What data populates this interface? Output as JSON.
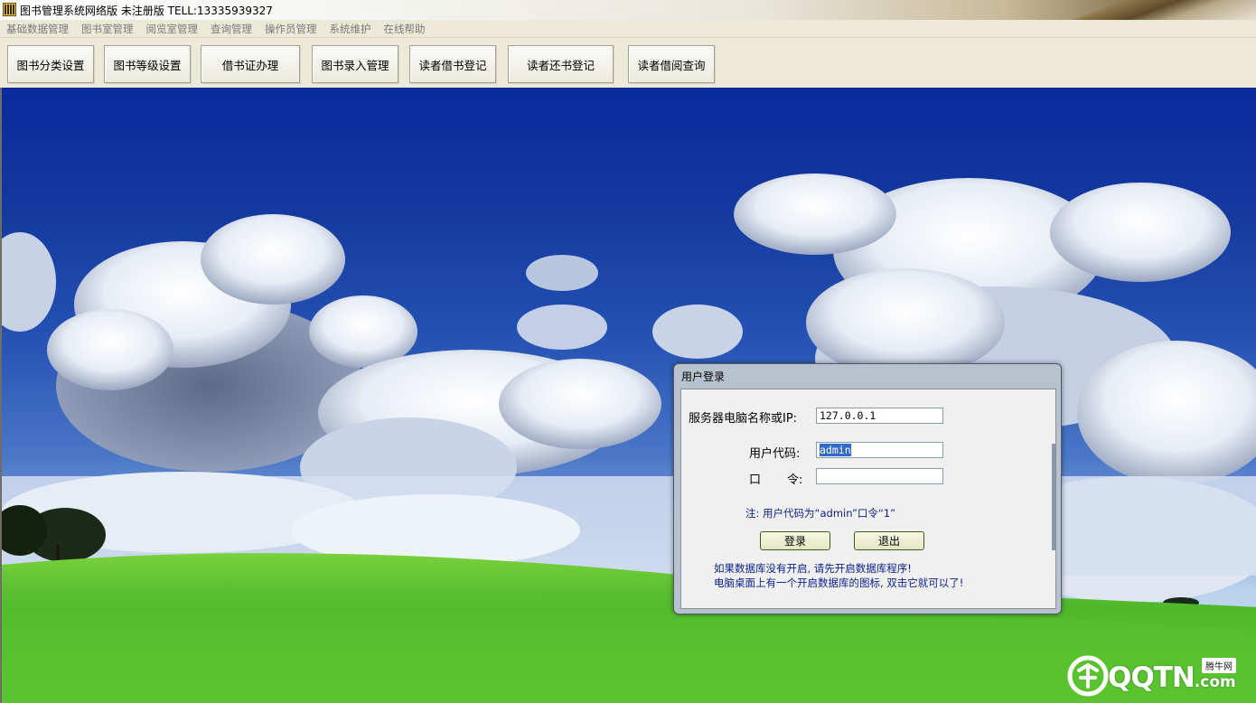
{
  "window": {
    "title": "图书管理系统网络版 未注册版 TELL:13335939327"
  },
  "menubar": {
    "items": [
      "基础数据管理",
      "图书室管理",
      "阅览室管理",
      "查询管理",
      "操作员管理",
      "系统维护",
      "在线帮助"
    ]
  },
  "toolbar": {
    "buttons": [
      "图书分类设置",
      "图书等级设置",
      "借书证办理",
      "图书录入管理",
      "读者借书登记",
      "读者还书登记",
      "读者借阅查询"
    ]
  },
  "login_dialog": {
    "title": "用户登录",
    "server_label": "服务器电脑名称或IP:",
    "server_value": "127.0.0.1",
    "user_label": "用户代码:",
    "user_value": "admin",
    "password_label_1": "口",
    "password_label_2": "令:",
    "password_value": "",
    "hint": "注: 用户代码为“admin”口令“1”",
    "login_button": "登录",
    "exit_button": "退出",
    "db_note_1": "如果数据库没有开启, 请先开启数据库程序!",
    "db_note_2": "电脑桌面上有一个开启数据库的图标, 双击它就可以了!"
  },
  "watermark": {
    "brand_main": "QQTN",
    "brand_suffix": ".com",
    "badge": "腾牛网"
  },
  "colors": {
    "sky_top": "#0a2a9c",
    "grass": "#4fb82a",
    "note_text": "#0a1f8c",
    "selection": "#316ac5"
  }
}
